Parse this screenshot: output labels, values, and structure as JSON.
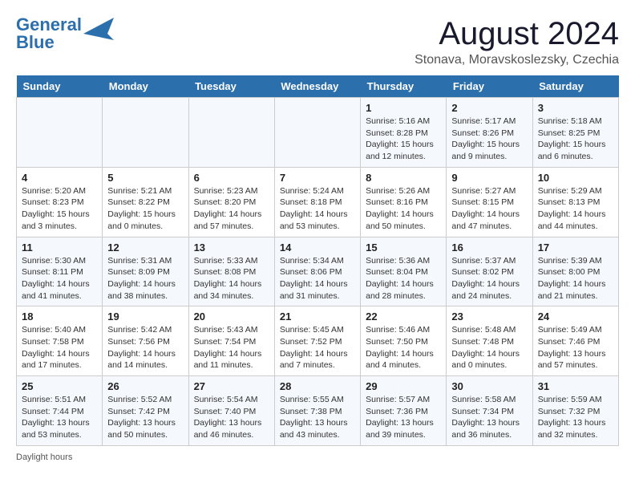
{
  "header": {
    "logo_line1": "General",
    "logo_line2": "Blue",
    "month_title": "August 2024",
    "location": "Stonava, Moravskoslezsky, Czechia"
  },
  "columns": [
    "Sunday",
    "Monday",
    "Tuesday",
    "Wednesday",
    "Thursday",
    "Friday",
    "Saturday"
  ],
  "weeks": [
    [
      {
        "day": "",
        "detail": ""
      },
      {
        "day": "",
        "detail": ""
      },
      {
        "day": "",
        "detail": ""
      },
      {
        "day": "",
        "detail": ""
      },
      {
        "day": "1",
        "detail": "Sunrise: 5:16 AM\nSunset: 8:28 PM\nDaylight: 15 hours and 12 minutes."
      },
      {
        "day": "2",
        "detail": "Sunrise: 5:17 AM\nSunset: 8:26 PM\nDaylight: 15 hours and 9 minutes."
      },
      {
        "day": "3",
        "detail": "Sunrise: 5:18 AM\nSunset: 8:25 PM\nDaylight: 15 hours and 6 minutes."
      }
    ],
    [
      {
        "day": "4",
        "detail": "Sunrise: 5:20 AM\nSunset: 8:23 PM\nDaylight: 15 hours and 3 minutes."
      },
      {
        "day": "5",
        "detail": "Sunrise: 5:21 AM\nSunset: 8:22 PM\nDaylight: 15 hours and 0 minutes."
      },
      {
        "day": "6",
        "detail": "Sunrise: 5:23 AM\nSunset: 8:20 PM\nDaylight: 14 hours and 57 minutes."
      },
      {
        "day": "7",
        "detail": "Sunrise: 5:24 AM\nSunset: 8:18 PM\nDaylight: 14 hours and 53 minutes."
      },
      {
        "day": "8",
        "detail": "Sunrise: 5:26 AM\nSunset: 8:16 PM\nDaylight: 14 hours and 50 minutes."
      },
      {
        "day": "9",
        "detail": "Sunrise: 5:27 AM\nSunset: 8:15 PM\nDaylight: 14 hours and 47 minutes."
      },
      {
        "day": "10",
        "detail": "Sunrise: 5:29 AM\nSunset: 8:13 PM\nDaylight: 14 hours and 44 minutes."
      }
    ],
    [
      {
        "day": "11",
        "detail": "Sunrise: 5:30 AM\nSunset: 8:11 PM\nDaylight: 14 hours and 41 minutes."
      },
      {
        "day": "12",
        "detail": "Sunrise: 5:31 AM\nSunset: 8:09 PM\nDaylight: 14 hours and 38 minutes."
      },
      {
        "day": "13",
        "detail": "Sunrise: 5:33 AM\nSunset: 8:08 PM\nDaylight: 14 hours and 34 minutes."
      },
      {
        "day": "14",
        "detail": "Sunrise: 5:34 AM\nSunset: 8:06 PM\nDaylight: 14 hours and 31 minutes."
      },
      {
        "day": "15",
        "detail": "Sunrise: 5:36 AM\nSunset: 8:04 PM\nDaylight: 14 hours and 28 minutes."
      },
      {
        "day": "16",
        "detail": "Sunrise: 5:37 AM\nSunset: 8:02 PM\nDaylight: 14 hours and 24 minutes."
      },
      {
        "day": "17",
        "detail": "Sunrise: 5:39 AM\nSunset: 8:00 PM\nDaylight: 14 hours and 21 minutes."
      }
    ],
    [
      {
        "day": "18",
        "detail": "Sunrise: 5:40 AM\nSunset: 7:58 PM\nDaylight: 14 hours and 17 minutes."
      },
      {
        "day": "19",
        "detail": "Sunrise: 5:42 AM\nSunset: 7:56 PM\nDaylight: 14 hours and 14 minutes."
      },
      {
        "day": "20",
        "detail": "Sunrise: 5:43 AM\nSunset: 7:54 PM\nDaylight: 14 hours and 11 minutes."
      },
      {
        "day": "21",
        "detail": "Sunrise: 5:45 AM\nSunset: 7:52 PM\nDaylight: 14 hours and 7 minutes."
      },
      {
        "day": "22",
        "detail": "Sunrise: 5:46 AM\nSunset: 7:50 PM\nDaylight: 14 hours and 4 minutes."
      },
      {
        "day": "23",
        "detail": "Sunrise: 5:48 AM\nSunset: 7:48 PM\nDaylight: 14 hours and 0 minutes."
      },
      {
        "day": "24",
        "detail": "Sunrise: 5:49 AM\nSunset: 7:46 PM\nDaylight: 13 hours and 57 minutes."
      }
    ],
    [
      {
        "day": "25",
        "detail": "Sunrise: 5:51 AM\nSunset: 7:44 PM\nDaylight: 13 hours and 53 minutes."
      },
      {
        "day": "26",
        "detail": "Sunrise: 5:52 AM\nSunset: 7:42 PM\nDaylight: 13 hours and 50 minutes."
      },
      {
        "day": "27",
        "detail": "Sunrise: 5:54 AM\nSunset: 7:40 PM\nDaylight: 13 hours and 46 minutes."
      },
      {
        "day": "28",
        "detail": "Sunrise: 5:55 AM\nSunset: 7:38 PM\nDaylight: 13 hours and 43 minutes."
      },
      {
        "day": "29",
        "detail": "Sunrise: 5:57 AM\nSunset: 7:36 PM\nDaylight: 13 hours and 39 minutes."
      },
      {
        "day": "30",
        "detail": "Sunrise: 5:58 AM\nSunset: 7:34 PM\nDaylight: 13 hours and 36 minutes."
      },
      {
        "day": "31",
        "detail": "Sunrise: 5:59 AM\nSunset: 7:32 PM\nDaylight: 13 hours and 32 minutes."
      }
    ]
  ],
  "footer": "Daylight hours"
}
